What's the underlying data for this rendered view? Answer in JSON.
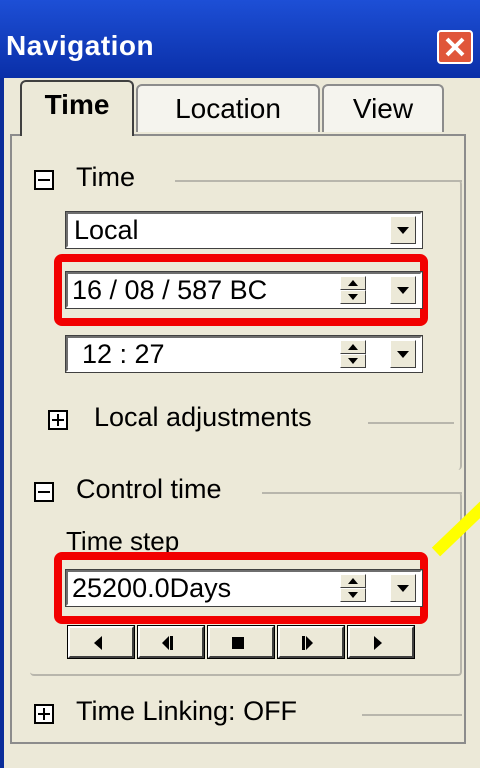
{
  "window": {
    "title": "Navigation"
  },
  "tabs": [
    {
      "label": "Time",
      "active": true
    },
    {
      "label": "Location",
      "active": false
    },
    {
      "label": "View",
      "active": false
    }
  ],
  "time_group": {
    "header": "Time",
    "mode_select": "Local",
    "date_value": "16 / 08 /  587  BC",
    "time_value": "12 : 27",
    "local_adjustments": "Local adjustments"
  },
  "control_group": {
    "header": "Control time",
    "time_step_label": "Time step",
    "time_step_value": "25200.0Days"
  },
  "time_linking": "Time Linking: OFF",
  "colors": {
    "highlight": "#f20000",
    "arrow": "#ffff00",
    "titlebar": "#0b2d9a"
  }
}
